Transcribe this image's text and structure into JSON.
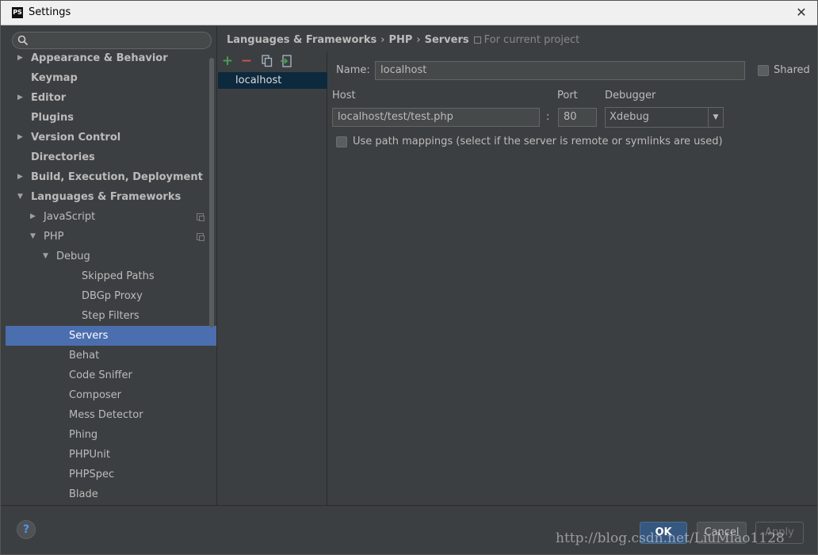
{
  "window": {
    "title": "Settings",
    "app_badge": "PS"
  },
  "search": {
    "placeholder": "",
    "value": ""
  },
  "nav": {
    "items": [
      {
        "label": "Appearance & Behavior",
        "level": 0,
        "arrow": "collapsed",
        "bold": true
      },
      {
        "label": "Keymap",
        "level": 0,
        "arrow": "none",
        "bold": true
      },
      {
        "label": "Editor",
        "level": 0,
        "arrow": "collapsed",
        "bold": true
      },
      {
        "label": "Plugins",
        "level": 0,
        "arrow": "none",
        "bold": true
      },
      {
        "label": "Version Control",
        "level": 0,
        "arrow": "collapsed",
        "bold": true
      },
      {
        "label": "Directories",
        "level": 0,
        "arrow": "none",
        "bold": true
      },
      {
        "label": "Build, Execution, Deployment",
        "level": 0,
        "arrow": "collapsed",
        "bold": true
      },
      {
        "label": "Languages & Frameworks",
        "level": 0,
        "arrow": "expanded",
        "bold": true
      },
      {
        "label": "JavaScript",
        "level": 1,
        "arrow": "collapsed",
        "bold": false,
        "project": true
      },
      {
        "label": "PHP",
        "level": 1,
        "arrow": "expanded",
        "bold": false,
        "project": true
      },
      {
        "label": "Debug",
        "level": 2,
        "arrow": "expanded",
        "bold": false
      },
      {
        "label": "Skipped Paths",
        "level": 4,
        "arrow": "none",
        "bold": false
      },
      {
        "label": "DBGp Proxy",
        "level": 4,
        "arrow": "none",
        "bold": false
      },
      {
        "label": "Step Filters",
        "level": 4,
        "arrow": "none",
        "bold": false
      },
      {
        "label": "Servers",
        "level": 3,
        "arrow": "none",
        "bold": false,
        "selected": true
      },
      {
        "label": "Behat",
        "level": 3,
        "arrow": "none",
        "bold": false
      },
      {
        "label": "Code Sniffer",
        "level": 3,
        "arrow": "none",
        "bold": false
      },
      {
        "label": "Composer",
        "level": 3,
        "arrow": "none",
        "bold": false
      },
      {
        "label": "Mess Detector",
        "level": 3,
        "arrow": "none",
        "bold": false
      },
      {
        "label": "Phing",
        "level": 3,
        "arrow": "none",
        "bold": false
      },
      {
        "label": "PHPUnit",
        "level": 3,
        "arrow": "none",
        "bold": false
      },
      {
        "label": "PHPSpec",
        "level": 3,
        "arrow": "none",
        "bold": false
      },
      {
        "label": "Blade",
        "level": 3,
        "arrow": "none",
        "bold": false
      }
    ]
  },
  "breadcrumb": {
    "items": [
      "Languages & Frameworks",
      "PHP",
      "Servers"
    ],
    "scope": "For current project"
  },
  "servers": {
    "toolbar": {
      "add": "+",
      "remove": "−"
    },
    "items": [
      "localhost"
    ]
  },
  "form": {
    "name_label": "Name:",
    "name_value": "localhost",
    "shared_label": "Shared",
    "shared_checked": false,
    "host_label": "Host",
    "host_value": "localhost/test/test.php",
    "colon": ":",
    "port_label": "Port",
    "port_value": "80",
    "debugger_label": "Debugger",
    "debugger_value": "Xdebug",
    "path_mappings_label": "Use path mappings (select if the server is remote or symlinks are used)",
    "path_mappings_checked": false
  },
  "footer": {
    "help": "?",
    "ok": "OK",
    "cancel": "Cancel",
    "apply": "Apply",
    "watermark": "http://blog.csdn.net/LiuMiao1128"
  },
  "colors": {
    "background": "#3c3f41",
    "selection": "#4b6eaf",
    "list_selection": "#0d293e",
    "ok_button": "#365880",
    "add_icon": "#499c54",
    "remove_icon": "#c75450"
  }
}
